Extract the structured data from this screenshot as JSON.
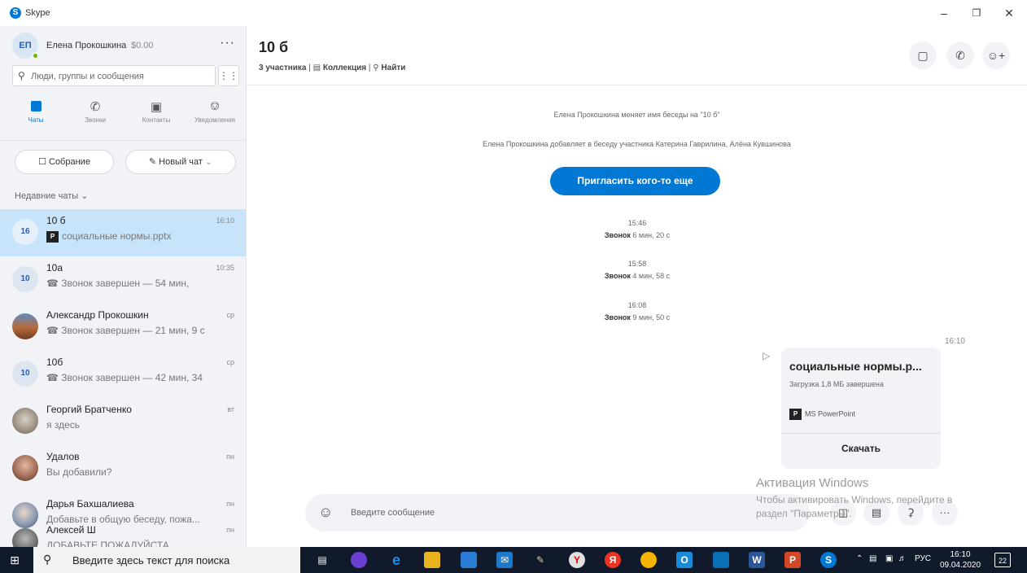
{
  "window": {
    "app_title": "Skype",
    "minimize": "–",
    "maximize": "❐",
    "close": "✕"
  },
  "profile": {
    "initials": "ЕП",
    "name": "Елена Прокошкина",
    "balance": "$0.00",
    "more": "···"
  },
  "search": {
    "placeholder": "Люди, группы и сообщения"
  },
  "nav_tabs": [
    {
      "label": "Чаты",
      "icon": "chat-icon"
    },
    {
      "label": "Звонки",
      "icon": "phone-icon"
    },
    {
      "label": "Контакты",
      "icon": "contacts-icon"
    },
    {
      "label": "Уведомления",
      "icon": "bell-icon"
    }
  ],
  "actions": {
    "meeting": "Собрание",
    "new_chat": "Новый чат"
  },
  "recent_header": "Недавние чаты",
  "chats": [
    {
      "avatar": "16",
      "name": "10 б",
      "time": "16:10",
      "preview": "социальные нормы.pptx",
      "icon": "ppt-icon"
    },
    {
      "avatar": "10",
      "name": "10а",
      "time": "10:35",
      "preview": "Звонок завершен — 54 мин,",
      "icon": "call-ended-icon"
    },
    {
      "avatar": "",
      "name": "Александр Прокошкин",
      "time": "ср",
      "preview": "Звонок завершен — 21 мин, 9 с",
      "icon": "call-ended-icon"
    },
    {
      "avatar": "10",
      "name": "10б",
      "time": "ср",
      "preview": "Звонок завершен — 42 мин, 34",
      "icon": "call-ended-icon"
    },
    {
      "avatar": "",
      "name": "Георгий Братченко",
      "time": "вт",
      "preview": "я здесь",
      "icon": ""
    },
    {
      "avatar": "",
      "name": "Удалов",
      "time": "пн",
      "preview": "Вы добавили?",
      "icon": ""
    },
    {
      "avatar": "",
      "name": "Дарья Бахшалиева",
      "time": "пн",
      "preview": "Добавьте в общую беседу, пожа...",
      "icon": ""
    },
    {
      "avatar": "",
      "name": "Алексей Ш",
      "time": "пн",
      "preview": "ДОБАВЬТЕ ПОЖАЛУЙСТА",
      "icon": ""
    }
  ],
  "conversation": {
    "title": "10 б",
    "participants": "3 участника",
    "collection": "Коллекция",
    "find": "Найти",
    "system_messages": [
      "Елена Прокошкина меняет имя беседы на \"10 б\"",
      "Елена Прокошкина добавляет в беседу участника Катерина Гаврилина, Алёна Кувшинова"
    ],
    "invite_button": "Пригласить кого-то еще",
    "calls": [
      {
        "time": "15:46",
        "label": "Звонок",
        "duration": "6 мин, 20 с"
      },
      {
        "time": "15:58",
        "label": "Звонок",
        "duration": "4 мин, 58 с"
      },
      {
        "time": "16:08",
        "label": "Звонок",
        "duration": "9 мин, 50 с"
      }
    ],
    "file_message": {
      "time": "16:10",
      "file_name": "социальные нормы.р...",
      "status": "Загрузка 1,8 МБ завершена",
      "type": "MS PowerPoint",
      "download": "Скачать"
    },
    "composer_placeholder": "Введите сообщение"
  },
  "watermark": {
    "line1": "Активация Windows",
    "line2": "Чтобы активировать Windows, перейдите в",
    "line3": "раздел \"Параметры\"."
  },
  "taskbar": {
    "search_placeholder": "Введите здесь текст для поиска",
    "language": "РУС",
    "time": "16:10",
    "date": "09.04.2020",
    "notifications": "22"
  }
}
